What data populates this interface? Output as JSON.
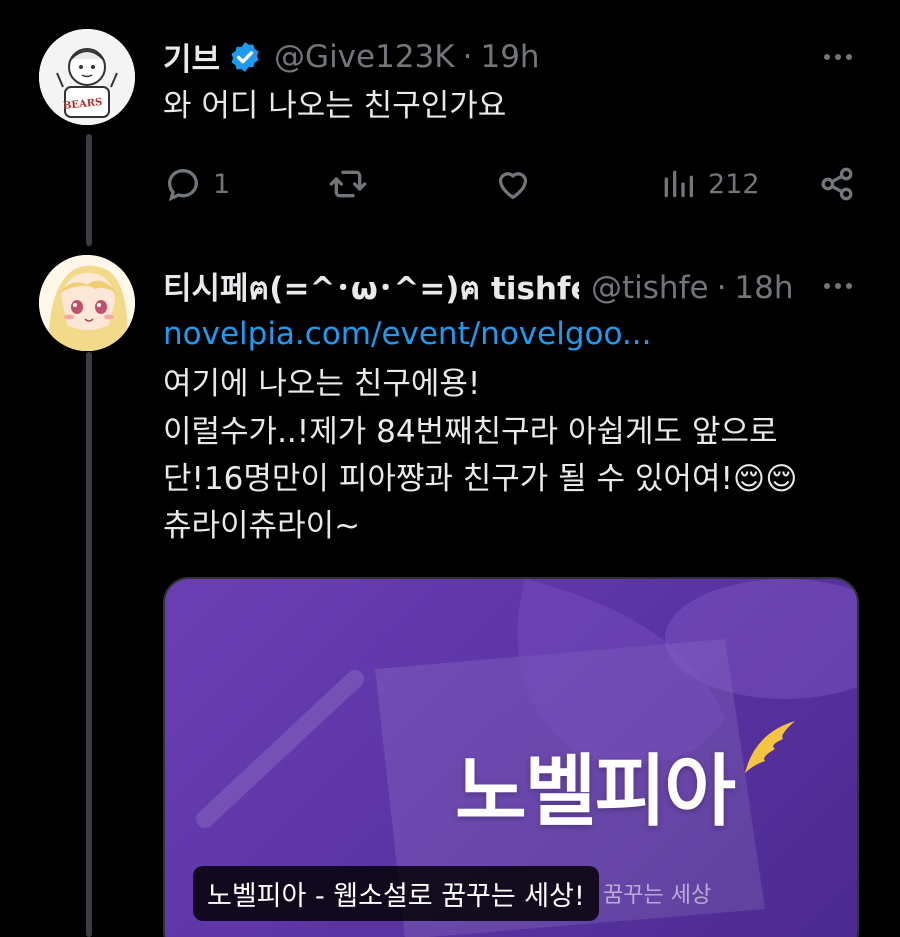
{
  "tweets": [
    {
      "display_name": "기브",
      "handle": "@Give123K",
      "separator": "·",
      "time": "19h",
      "text": "와 어디 나오는 친구인가요",
      "avatar_label": "BEARS",
      "actions": {
        "reply_count": "1",
        "retweet_count": "",
        "like_count": "",
        "view_count": "212"
      }
    },
    {
      "display_name": "티시페ฅ(=^･ω･^=)ฅ tishfe",
      "handle": "@tishfe",
      "separator": "·",
      "time": "18h",
      "link": "novelpia.com/event/novelgoo...",
      "lines": [
        "여기에 나오는 친구에용!",
        "이럴수가..!제가 84번째친구라 아쉽게도 앞으로",
        "단!16명만이 피아쨩과 친구가 될 수  있어여!😌😌",
        "츄라이츄라이~"
      ],
      "card": {
        "logo_text": "노벨피아",
        "caption": "노벨피아 - 웹소설로 꿈꾸는 세상!",
        "subtle_text": "꿈꾸는 세상",
        "background_color": "#5e36a8"
      }
    }
  ],
  "icons": {
    "reply": "reply-icon",
    "retweet": "retweet-icon",
    "like": "like-icon",
    "views": "views-icon",
    "share": "share-icon",
    "more": "more-icon",
    "verified": "verified-badge-icon"
  },
  "colors": {
    "background": "#000000",
    "text": "#e7e9ea",
    "muted": "#71767b",
    "link": "#1d9bf0",
    "verified": "#1d9bf0"
  }
}
